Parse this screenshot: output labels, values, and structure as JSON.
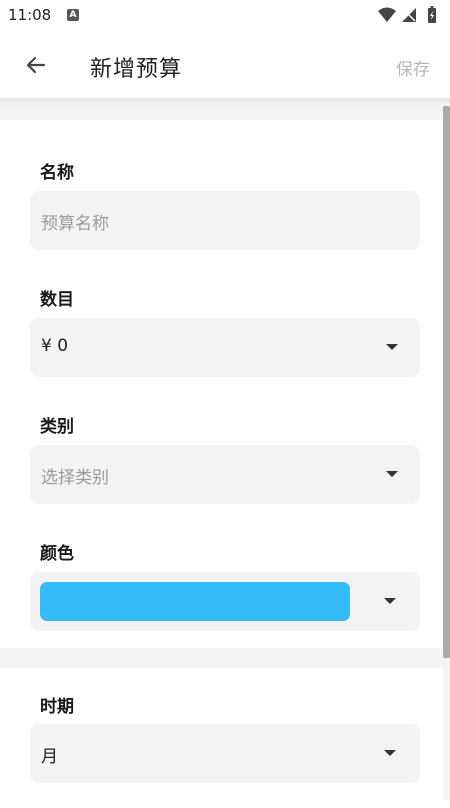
{
  "status": {
    "time": "11:08",
    "notification_letter": "A"
  },
  "app_bar": {
    "title": "新增预算",
    "save_label": "保存"
  },
  "form": {
    "name": {
      "label": "名称",
      "placeholder": "预算名称",
      "value": ""
    },
    "amount": {
      "label": "数目",
      "value": "¥ 0"
    },
    "category": {
      "label": "类别",
      "placeholder": "选择类别"
    },
    "color": {
      "label": "颜色",
      "selected_color": "#33bbf8"
    },
    "period": {
      "label": "时期",
      "value": "月"
    }
  },
  "icons": {
    "back": "arrow-left-icon",
    "wifi": "wifi-icon",
    "signal": "cellular-signal-icon",
    "battery": "battery-charging-icon",
    "dropdown": "caret-down-icon"
  }
}
